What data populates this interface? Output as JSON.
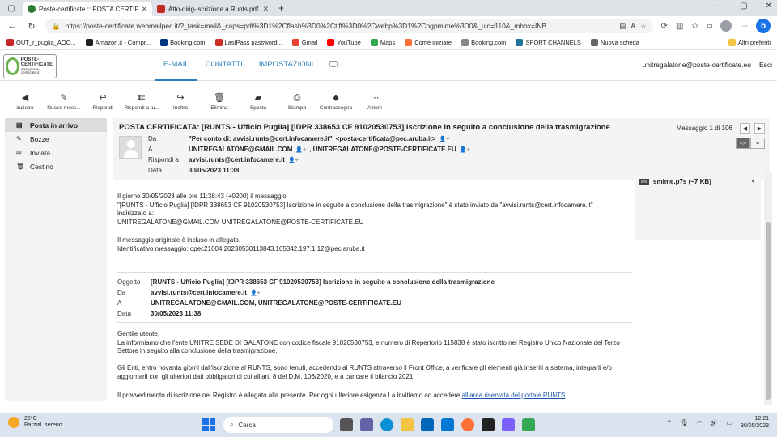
{
  "browser": {
    "tabs": [
      {
        "title": "Poste-certificate :: POSTA CERTIF",
        "active": true
      },
      {
        "title": "Atto-dirig-iscrizione a Runts.pdf",
        "active": false
      }
    ],
    "url": "https://poste-certificate.webmailpec.it/?_task=mail&_caps=pdf%3D1%2Cflash%3D0%2Ctiff%3D0%2Cwebp%3D1%2Cpgpmime%3D0&_uid=110&_mbox=INB...",
    "bookmarks": [
      "OUT_r_puglia_AOO...",
      "Amazon.it - Compr...",
      "Booking.com",
      "LastPass password...",
      "Gmail",
      "YouTube",
      "Maps",
      "Come iniziare",
      "Booking.com",
      "SPORT CHANNELS",
      "Nuova scheda"
    ],
    "other_favorites": "Altri preferiti"
  },
  "app": {
    "logo_main": "POSTE-CERTIFICATE",
    "logo_sub": "www.poste-certificate.it",
    "nav": [
      "E-MAIL",
      "CONTATTI",
      "IMPOSTAZIONI"
    ],
    "user": "unitregalatone@poste-certificate.eu",
    "logout": "Esci"
  },
  "toolbar": [
    {
      "label": "indietro",
      "icon": "back-circle-icon"
    },
    {
      "label": "Nuovo mess...",
      "icon": "pencil-icon"
    },
    {
      "label": "Rispondi",
      "icon": "reply-icon"
    },
    {
      "label": "Rispondi a tu...",
      "icon": "reply-all-icon"
    },
    {
      "label": "Inoltra",
      "icon": "forward-icon"
    },
    {
      "label": "Elimina",
      "icon": "trash-icon"
    },
    {
      "label": "Sposta",
      "icon": "folder-icon"
    },
    {
      "label": "Stampa",
      "icon": "print-icon"
    },
    {
      "label": "Contrassegna",
      "icon": "tag-icon"
    },
    {
      "label": "Azioni",
      "icon": "more-icon"
    }
  ],
  "folders": [
    {
      "label": "Posta in arrivo",
      "icon": "inbox-icon"
    },
    {
      "label": "Bozze",
      "icon": "pencil-icon"
    },
    {
      "label": "Inviata",
      "icon": "envelope-icon"
    },
    {
      "label": "Cestino",
      "icon": "trash-icon"
    }
  ],
  "message": {
    "subject": "POSTA CERTIFICATA: [RUNTS - Ufficio Puglia] [IDPR 338653 CF 91020530753] Iscrizione in seguito a conclusione della trasmigrazione",
    "counter": "Messaggio 1 di 106",
    "labels": {
      "from": "Da",
      "to": "A",
      "reply_to": "Rispondi a",
      "date": "Data"
    },
    "from_name": "\"Per conto di: avvisi.runts@cert.infocamere.it\"",
    "from_addr": "<posta-certificata@pec.aruba.it>",
    "to_1": "UNITREGALATONE@GMAIL.COM",
    "to_2": ", UNITREGALATONE@POSTE-CERTIFICATE.EU",
    "reply_to": "avvisi.runts@cert.infocamere.it",
    "date": "30/05/2023 11:38",
    "body": {
      "l1": "Il giorno 30/05/2023 alle ore 11:38:43 (+0200) il messaggio",
      "l2": "\"[RUNTS - Ufficio Puglia] [IDPR 338653 CF 91020530753] Iscrizione in seguito a conclusione della trasmigrazione\" è stato inviato da \"avvisi.runts@cert.infocamere.it\"",
      "l3": "indirizzato a:",
      "l4": "UNITREGALATONE@GMAIL.COM UNITREGALATONE@POSTE-CERTIFICATE.EU",
      "l5": "Il messaggio originale è incluso in allegato.",
      "l6": "Identificativo messaggio: opec21004.20230530113843.105342.197.1.12@pec.aruba.it"
    },
    "inner": {
      "labels": {
        "subject": "Oggetto",
        "from": "Da",
        "to": "A",
        "date": "Data"
      },
      "subject": "[RUNTS - Ufficio Puglia] [IDPR 338653 CF 91020530753] Iscrizione in seguito a conclusione della trasmigrazione",
      "from": "avvisi.runts@cert.infocamere.it",
      "to": "UNITREGALATONE@GMAIL.COM, UNITREGALATONE@POSTE-CERTIFICATE.EU",
      "date": "30/05/2023 11:38",
      "greeting": "Gentile utente,",
      "p1": "La informiamo che l'ente UNITRE SEDE DI GALATONE con codice fiscale 91020530753, e numero di Repertorio 115838 è stato iscritto nel Registro Unico Nazionale del Terzo Settore in seguito alla conclusione della trasmigrazione.",
      "p2": "Gli Enti, entro novanta giorni dall'iscrizione al RUNTS, sono tenuti, accedendo al RUNTS attraverso il Front Office, a verificare gli elementi già inseriti a sistema, integrarli e/o aggiornarli con gli ulteriori dati obbligatori di cui all'art. 8 del D.M. 106/2020, e a caricare il bilancio 2021.",
      "p3": "Il provvedimento di iscrizione nel Registro è allegato alla presente. Per ogni ulteriore esigenza La invitiamo ad accedere ",
      "p3_link": "all'area riservata del portale RUNTS",
      "p3_end": "."
    },
    "attachment": "smime.p7s (~7 KB)"
  },
  "taskbar": {
    "temp": "25°C",
    "weather": "Parzial. sereno",
    "search": "Cerca",
    "time": "12:21",
    "date": "30/05/2023"
  }
}
